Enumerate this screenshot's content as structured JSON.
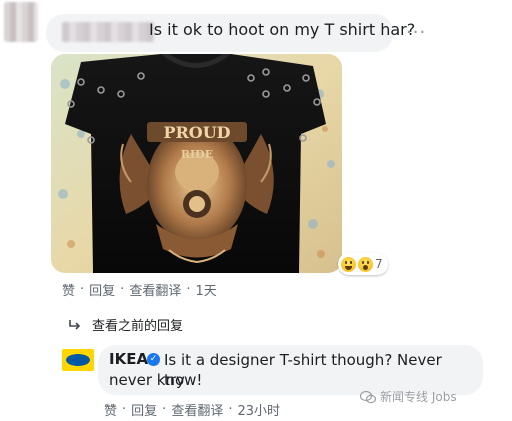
{
  "top_comment": {
    "text": "Is it ok to hoot on my T shirt har?",
    "more": "···",
    "reaction_count": "7",
    "actions": {
      "like": "赞",
      "reply": "回复",
      "translate": "查看翻译",
      "time": "1天"
    }
  },
  "view_previous_replies": "查看之前的回复",
  "reply": {
    "author": "IKEA",
    "text_line1": "Is it a designer T-shirt though? Never try",
    "text_line2": "never know!",
    "actions": {
      "like": "赞",
      "reply": "回复",
      "translate": "查看翻译",
      "time": "23小时"
    }
  },
  "photo": {
    "shirt_text_top": "PROUD",
    "shirt_text_bottom": "RIDE"
  },
  "watermark": "新闻专线 Jobs"
}
